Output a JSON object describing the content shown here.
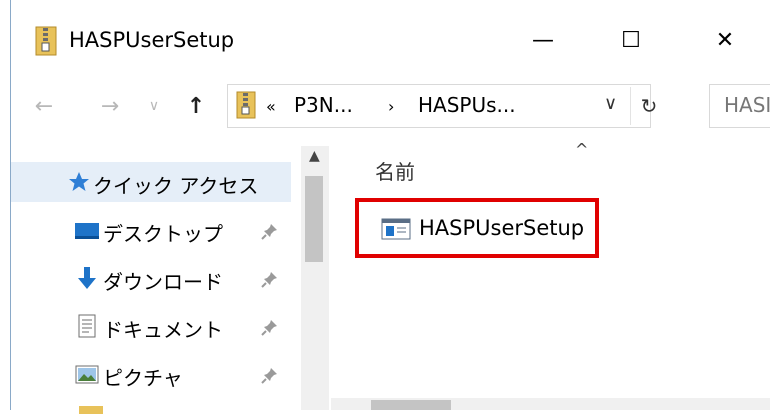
{
  "window": {
    "title": "HASPUserSetup",
    "minimize_glyph": "—",
    "maximize_glyph": "☐",
    "close_glyph": "✕"
  },
  "nav": {
    "back_glyph": "←",
    "forward_glyph": "→",
    "recent_glyph": "∨",
    "up_glyph": "↑"
  },
  "address": {
    "more_glyph": "«",
    "crumbs": [
      "P3N...",
      "HASPUs..."
    ],
    "separator": "›",
    "dropdown_glyph": "∨",
    "refresh_glyph": "↻"
  },
  "search": {
    "text": "HASI"
  },
  "sidebar": {
    "items": [
      {
        "label": "クイック アクセス",
        "icon": "star-icon"
      },
      {
        "label": "デスクトップ",
        "icon": "desktop-icon"
      },
      {
        "label": "ダウンロード",
        "icon": "download-icon"
      },
      {
        "label": "ドキュメント",
        "icon": "document-icon"
      },
      {
        "label": "ピクチャ",
        "icon": "picture-icon"
      }
    ]
  },
  "content": {
    "column_header": "名前",
    "sort_caret": "^",
    "files": [
      {
        "label": "HASPUserSetup",
        "icon": "installer-icon"
      }
    ]
  },
  "colors": {
    "highlight": "#e00000",
    "selection_bg": "#e5eef8",
    "accent": "#0078d7"
  }
}
